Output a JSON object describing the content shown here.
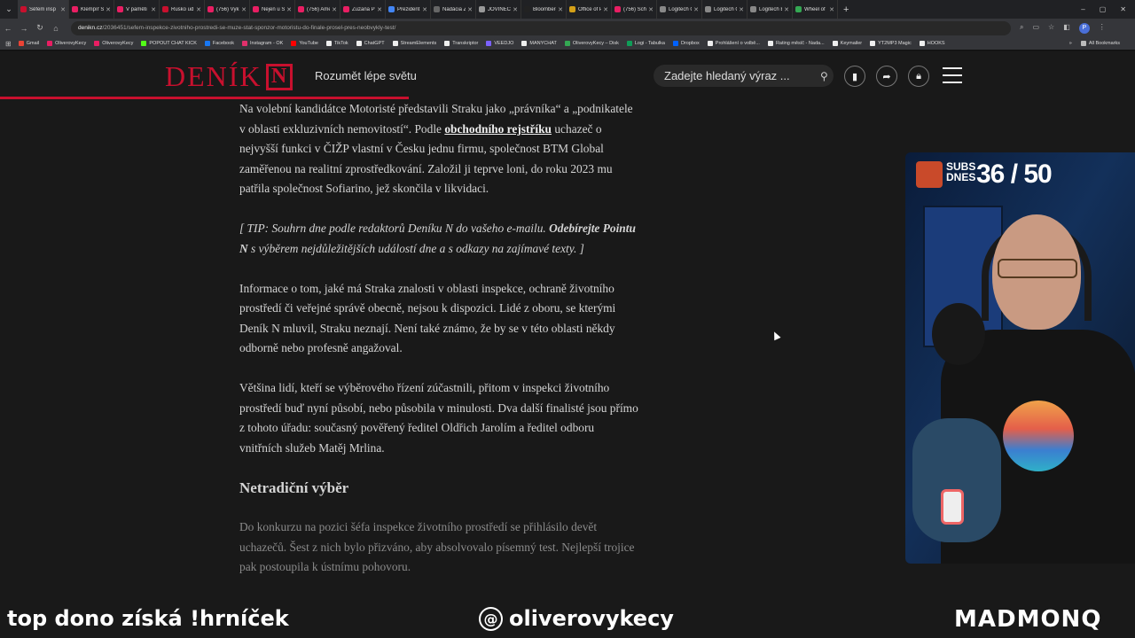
{
  "browser": {
    "tabs": [
      {
        "title": "Šéfem insp",
        "color": "#c8102e",
        "active": true
      },
      {
        "title": "Klempíř S",
        "color": "#e91e63"
      },
      {
        "title": "V paměti",
        "color": "#e91e63"
      },
      {
        "title": "Rusko ud",
        "color": "#c8102e"
      },
      {
        "title": "(756) Vyk",
        "color": "#e91e63"
      },
      {
        "title": "Nejen u S",
        "color": "#e91e63"
      },
      {
        "title": "(756) Ame",
        "color": "#e91e63"
      },
      {
        "title": "Zuzana Pi",
        "color": "#e91e63"
      },
      {
        "title": "Prezident",
        "color": "#4285f4"
      },
      {
        "title": "Nadácia Z",
        "color": "#666666"
      },
      {
        "title": "JOVINEČ",
        "color": "#999999"
      },
      {
        "title": "Bloomberg",
        "color": "#222222"
      },
      {
        "title": "Office of P",
        "color": "#d4a017"
      },
      {
        "title": "(756) Schi",
        "color": "#e91e63"
      },
      {
        "title": "Logitech G",
        "color": "#888888"
      },
      {
        "title": "Logitech G",
        "color": "#888888"
      },
      {
        "title": "Logitech E",
        "color": "#888888"
      },
      {
        "title": "Wheel of",
        "color": "#34a853"
      }
    ],
    "new_tab": "+",
    "window_controls": [
      "–",
      "▢",
      "✕"
    ],
    "url_domain": "denikn.cz",
    "url_path": "/2036451/sefem-inspekce-zivotniho-prostredi-se-muze-stat-sponzor-motoristu-do-finale-prosel-pres-neobvykly-test/",
    "bookmarks": [
      {
        "label": "Gmail",
        "color": "#ea4335"
      },
      {
        "label": "OliverovyKecy",
        "color": "#e91e63"
      },
      {
        "label": "OliverovyKecy",
        "color": "#e91e63"
      },
      {
        "label": "POPOUT CHAT KICK",
        "color": "#53fc18"
      },
      {
        "label": "Facebook",
        "color": "#1877f2"
      },
      {
        "label": "Instagram - OK",
        "color": "#e1306c"
      },
      {
        "label": "YouTube",
        "color": "#ff0000"
      },
      {
        "label": "TikTok",
        "color": "#eeeeee"
      },
      {
        "label": "ChatGPT",
        "color": "#eeeeee"
      },
      {
        "label": "StreamElements",
        "color": "#eeeeee"
      },
      {
        "label": "Transkriptor",
        "color": "#eeeeee"
      },
      {
        "label": "VEEDJO",
        "color": "#7b61ff"
      },
      {
        "label": "MANYCHAT",
        "color": "#eeeeee"
      },
      {
        "label": "OliverovyKecy – Disk",
        "color": "#34a853"
      },
      {
        "label": "Logi - Tabulka",
        "color": "#0f9d58"
      },
      {
        "label": "Dropbox",
        "color": "#0061ff"
      },
      {
        "label": "Prohlášení o volbě...",
        "color": "#eeeeee"
      },
      {
        "label": "Rating měsíč - Nada...",
        "color": "#eeeeee"
      },
      {
        "label": "Keymailer",
        "color": "#eeeeee"
      },
      {
        "label": "YT2MP3 Magic",
        "color": "#eeeeee"
      },
      {
        "label": "HOOKS",
        "color": "#eeeeee"
      }
    ],
    "all_bookmarks": "All Bookmarks",
    "profile_letter": "P"
  },
  "site": {
    "logo_text": "DENÍK",
    "logo_letter": "N",
    "tagline": "Rozumět lépe světu",
    "search_placeholder": "Zadejte hledaný výraz ...",
    "brand_color": "#c8102e",
    "reading_progress": 0.36
  },
  "article": {
    "p1_before": "Na volební kandidátce Motoristé představili Straku jako „právníka“ a „podnikatele v oblasti exkluzivních nemovitostí“. Podle ",
    "p1_link": "obchodního rejstříku",
    "p1_after": " uchazeč o nejvyšší funkci v ČIŽP vlastní v Česku jednu firmu, společnost BTM Global zaměřenou na realitní zprostředkování. Založil ji teprve loni, do roku 2023 mu patřila společnost Sofiarino, jež skončila v likvidaci.",
    "tip_before": "[ TIP: Souhrn dne podle redaktorů Deníku N do vašeho e-mailu. ",
    "tip_link": "Odebírejte Pointu N",
    "tip_after": " s výběrem nejdůležitějších událostí dne a s odkazy na zajímavé texty. ]",
    "p2": "Informace o tom, jaké má Straka znalosti v oblasti inspekce, ochraně životního prostředí či veřejné správě obecně, nejsou k dispozici. Lidé z oboru, se kterými Deník N mluvil, Straku neznají. Není také známo, že by se v této oblasti někdy odborně nebo profesně angažoval.",
    "p3": "Většina lidí, kteří se výběrového řízení zúčastnili, přitom v inspekci životního prostředí buď nyní působí, nebo působila v minulosti. Dva další finalisté jsou přímo z tohoto úřadu: současný pověřený ředitel Oldřich Jarolím a ředitel odboru vnitřních služeb Matěj Mrlina.",
    "heading": "Netradiční výběr",
    "p4": "Do konkurzu na pozici šéfa inspekce životního prostředí se přihlásilo devět uchazečů. Šest z nich bylo přizváno, aby absolvovalo písemný test. Nejlepší trojice pak postoupila k ústnímu pohovoru."
  },
  "stream": {
    "subs_label_1": "SUBS",
    "subs_label_2": "DNES",
    "subs_count": "36 / 50",
    "bottom_left": "top dono získá !hrníček",
    "bottom_center": "oliverovykecy",
    "bottom_right": "MADMONQ"
  }
}
